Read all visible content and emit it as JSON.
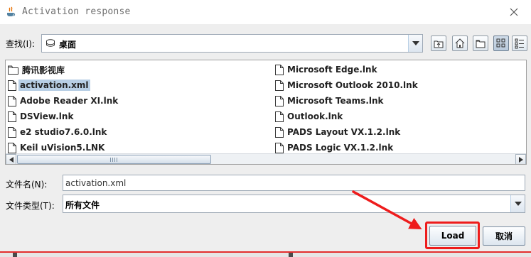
{
  "window": {
    "title": "Activation response",
    "close_label": "×"
  },
  "look_in": {
    "label": "查找(I):",
    "value": "桌面"
  },
  "toolbar": {
    "icons": [
      "up-one-level-icon",
      "home-icon",
      "new-folder-icon",
      "list-view-icon",
      "details-view-icon"
    ]
  },
  "files": {
    "column1": [
      "腾讯影视库",
      "activation.xml",
      "Adobe Reader XI.lnk",
      "DSView.lnk",
      "e2 studio7.6.0.lnk",
      "Keil uVision5.LNK"
    ],
    "column2": [
      "Microsoft Edge.lnk",
      "Microsoft Outlook 2010.lnk",
      "Microsoft Teams.lnk",
      "Outlook.lnk",
      "PADS Layout VX.1.2.lnk",
      "PADS Logic VX.1.2.lnk"
    ]
  },
  "file_name": {
    "label": "文件名(N):",
    "value": "activation.xml"
  },
  "file_type": {
    "label": "文件类型(T):",
    "value": "所有文件"
  },
  "buttons": {
    "load": "Load",
    "cancel": "取消"
  },
  "colors": {
    "selection": "#b8cfe5",
    "annotation": "#ee1c1c",
    "button_border": "#7b8ea2"
  }
}
